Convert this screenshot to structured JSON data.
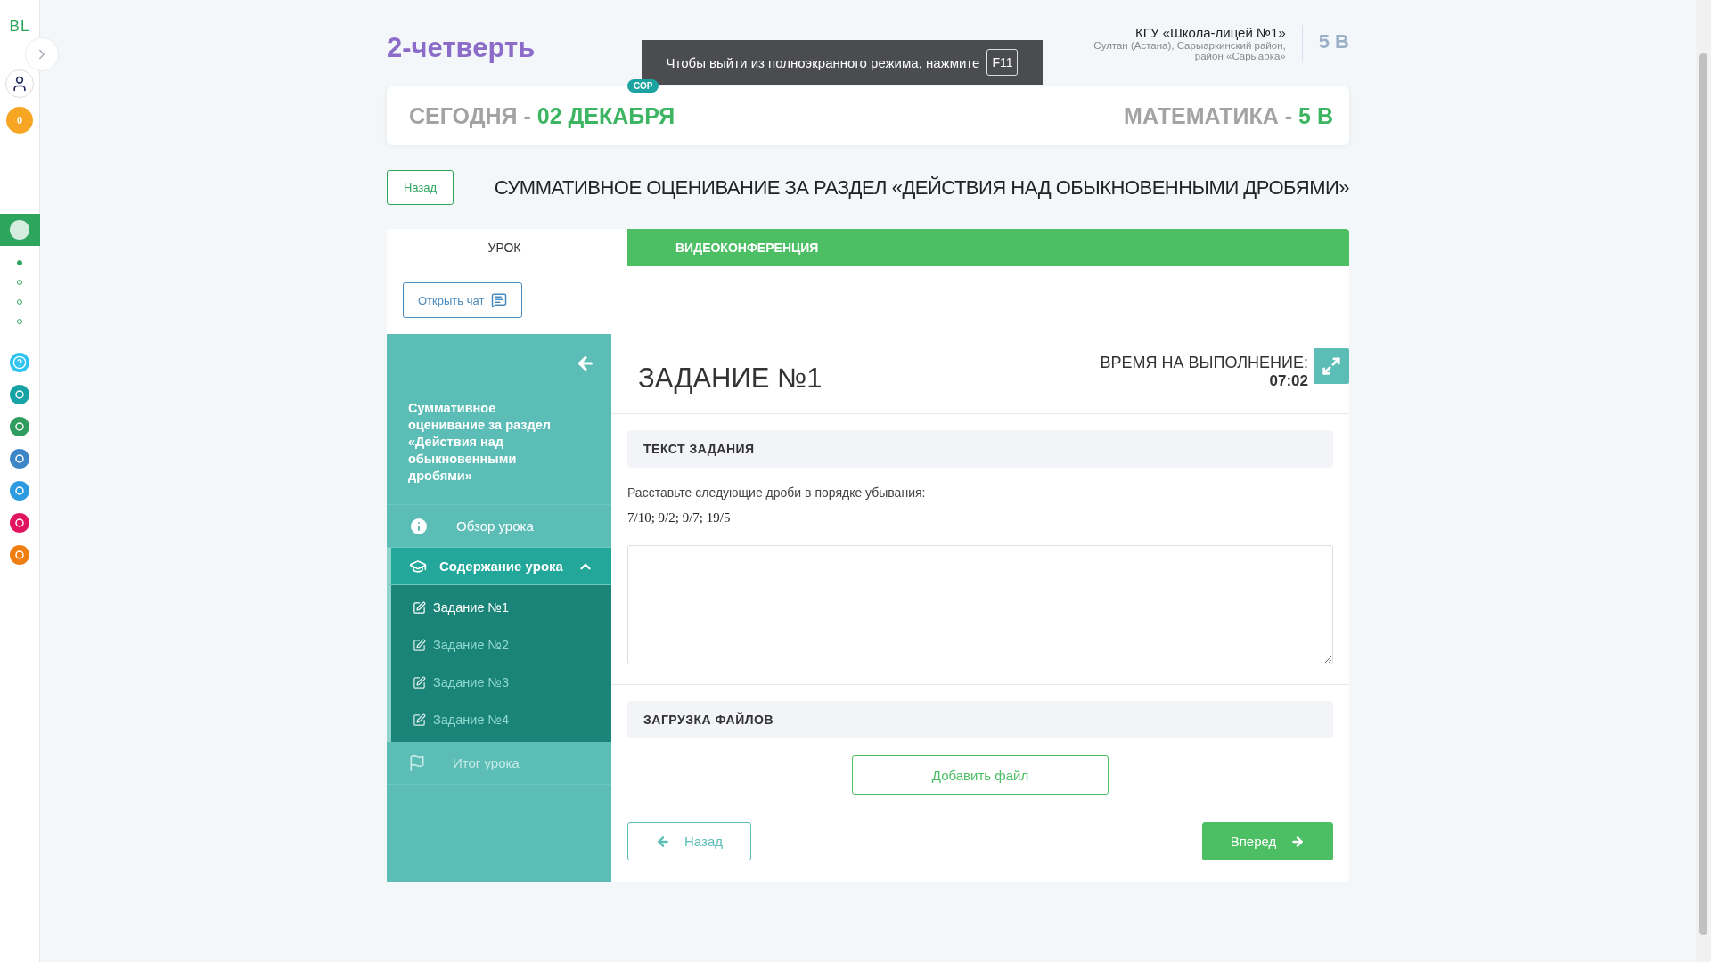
{
  "sidebar": {
    "logo": "BL",
    "coins": "0",
    "dots": [
      {
        "selected": true
      },
      {
        "selected": false
      },
      {
        "selected": false
      },
      {
        "selected": false
      }
    ],
    "apps": [
      {
        "color": "#2ec4f0",
        "kind": "help"
      },
      {
        "color": "#17a2a6",
        "kind": "app"
      },
      {
        "color": "#2f9d5e",
        "kind": "app"
      },
      {
        "color": "#3d86c6",
        "kind": "app"
      },
      {
        "color": "#2d9be0",
        "kind": "app"
      },
      {
        "color": "#e0145f",
        "kind": "app"
      },
      {
        "color": "#ef7d10",
        "kind": "app"
      }
    ]
  },
  "header": {
    "title": "2-четверть",
    "school": "КГУ «Школа-лицей №1»",
    "address": "Султан (Астана), Сарыаркинский район, район «Сарыарка»",
    "class": "5 В"
  },
  "fullscreen_notice": {
    "text": "Чтобы выйти из полноэкранного режима, нажмите",
    "key": "F11"
  },
  "today_card": {
    "badge": "СОР",
    "today_label": "СЕГОДНЯ -",
    "date": "02 ДЕКАБРЯ",
    "subject": "МАТЕМАТИКА -",
    "class": "5 В"
  },
  "back_button": "Назад",
  "lesson_title": "СУММАТИВНОЕ ОЦЕНИВАНИЕ ЗА РАЗДЕЛ «ДЕЙСТВИЯ НАД ОБЫКНОВЕННЫМИ ДРОБЯМИ»",
  "tabs": [
    {
      "label": "УРОК",
      "selected": true
    },
    {
      "label": "ВИДЕОКОНФЕРЕНЦИЯ",
      "selected": false
    }
  ],
  "chat_button": "Открыть чат",
  "lesson_nav": {
    "title": "Суммативное оценивание за раздел «Действия над обыкновенными дробями»",
    "items": [
      {
        "kind": "overview",
        "label": "Обзор урока",
        "disabled": false
      },
      {
        "kind": "contents",
        "label": "Содержание урока",
        "disabled": false,
        "expanded": true,
        "children": [
          {
            "label": "Задание №1",
            "selected": true
          },
          {
            "label": "Задание №2",
            "selected": false
          },
          {
            "label": "Задание №3",
            "selected": false
          },
          {
            "label": "Задание №4",
            "selected": false
          }
        ]
      },
      {
        "kind": "summary",
        "label": "Итог урока",
        "disabled": true
      }
    ]
  },
  "task": {
    "title": "ЗАДАНИЕ №1",
    "timer_label": "ВРЕМЯ НА ВЫПОЛНЕНИЕ:",
    "timer": "07:02",
    "text_heading": "ТЕКСТ ЗАДАНИЯ",
    "prompt": "Расставьте следующие дроби в порядке убывания:",
    "fractions": "7/10; 9/2; 9/7; 19/5",
    "upload_heading": "ЗАГРУЗКА ФАЙЛОВ",
    "add_file": "Добавить файл",
    "prev": "Назад",
    "next": "Вперед"
  }
}
